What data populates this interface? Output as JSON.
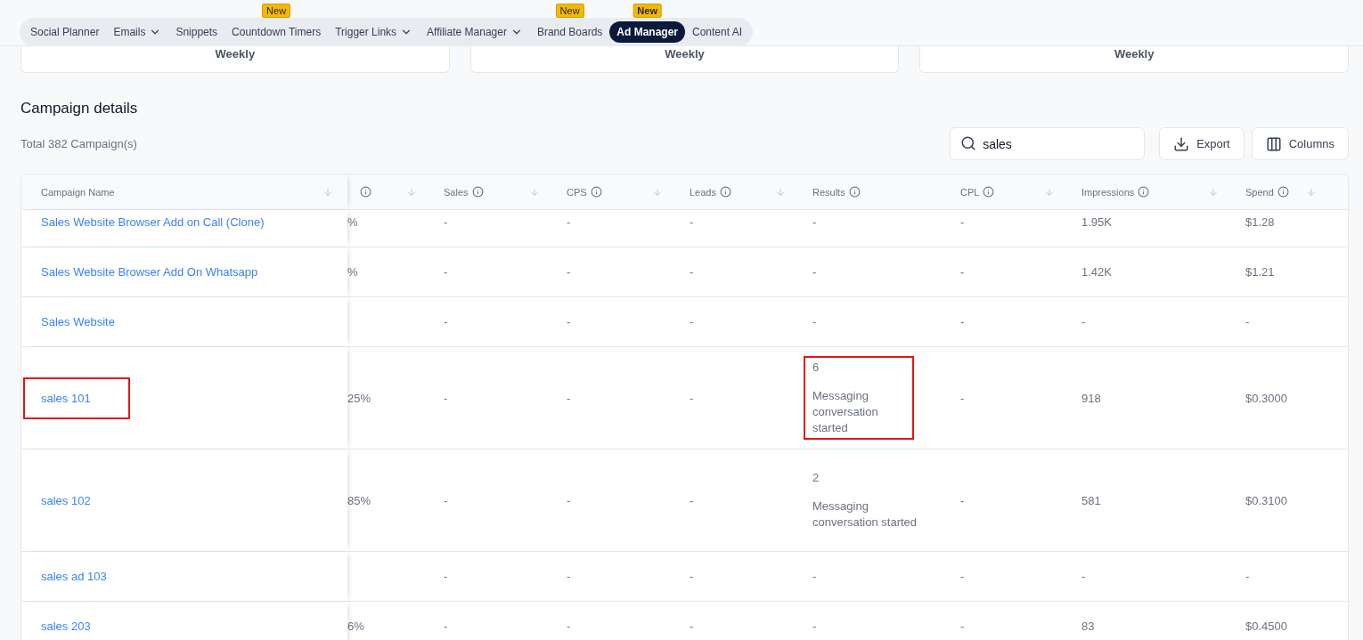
{
  "nav": {
    "items": [
      {
        "label": "Social Planner",
        "dropdown": false,
        "selected": false
      },
      {
        "label": "Emails",
        "dropdown": true,
        "selected": false
      },
      {
        "label": "Snippets",
        "dropdown": false,
        "selected": false
      },
      {
        "label": "Countdown Timers",
        "dropdown": false,
        "badge": "New",
        "selected": false
      },
      {
        "label": "Trigger Links",
        "dropdown": true,
        "selected": false
      },
      {
        "label": "Affiliate Manager",
        "dropdown": true,
        "selected": false
      },
      {
        "label": "Brand Boards",
        "dropdown": false,
        "badge": "New",
        "selected": false
      },
      {
        "label": "Ad Manager",
        "dropdown": false,
        "badge": "New",
        "selected": true
      },
      {
        "label": "Content AI",
        "dropdown": false,
        "selected": false
      }
    ]
  },
  "summary_cards": [
    {
      "period": "Weekly"
    },
    {
      "period": "Weekly"
    },
    {
      "period": "Weekly"
    }
  ],
  "section": {
    "title": "Campaign details",
    "total": "Total 382 Campaign(s)"
  },
  "search": {
    "value": "sales"
  },
  "buttons": [
    {
      "kind": "export",
      "label": "Export"
    },
    {
      "kind": "columns",
      "label": "Columns"
    }
  ],
  "table": {
    "columns": [
      {
        "label": "Campaign Name",
        "info": false,
        "sort": true
      },
      {
        "info": true,
        "sort": true
      },
      {
        "label": "Sales",
        "info": true,
        "sort": true
      },
      {
        "label": "CPS",
        "info": true,
        "sort": true
      },
      {
        "label": "Leads",
        "info": true,
        "sort": true
      },
      {
        "label": "Results",
        "info": true,
        "sort": false
      },
      {
        "label": "CPL",
        "info": true,
        "sort": true
      },
      {
        "label": "Impressions",
        "info": true,
        "sort": true
      },
      {
        "label": "Spend",
        "info": true,
        "sort": true
      }
    ],
    "rows": [
      {
        "name": "Sales Website Browser Add on Call (Clone)",
        "column_2": "%",
        "sales": "-",
        "cps": "-",
        "leads": "-",
        "results": {
          "value": "-"
        },
        "cpl": "-",
        "impressions": "1.95K",
        "spend": "$1.28",
        "highlighted": false
      },
      {
        "name": "Sales Website Browser Add On Whatsapp",
        "column_2": "%",
        "sales": "-",
        "cps": "-",
        "leads": "-",
        "results": {
          "value": "-"
        },
        "cpl": "-",
        "impressions": "1.42K",
        "spend": "$1.21",
        "highlighted": false
      },
      {
        "name": "Sales Website",
        "sales": "-",
        "cps": "-",
        "leads": "-",
        "results": {
          "value": "-"
        },
        "cpl": "-",
        "impressions": "-",
        "spend": "-",
        "highlighted": false
      },
      {
        "name": "sales 101",
        "column_2": "25%",
        "sales": "-",
        "cps": "-",
        "leads": "-",
        "results": {
          "value": "6",
          "label": "Messaging conversation started"
        },
        "cpl": "-",
        "impressions": "918",
        "spend": "$0.3000",
        "highlighted": true
      },
      {
        "name": "sales 102",
        "column_2": "85%",
        "sales": "-",
        "cps": "-",
        "leads": "-",
        "results": {
          "value": "2",
          "label": "Messaging conversation started"
        },
        "cpl": "-",
        "impressions": "581",
        "spend": "$0.3100",
        "highlighted": false
      },
      {
        "name": "sales ad 103",
        "sales": "-",
        "cps": "-",
        "leads": "-",
        "results": {
          "value": "-"
        },
        "cpl": "-",
        "impressions": "-",
        "spend": "-",
        "highlighted": false
      },
      {
        "name": "sales 203",
        "column_2": "6%",
        "sales": "-",
        "cps": "-",
        "leads": "-",
        "results": {
          "value": "-"
        },
        "cpl": "-",
        "impressions": "83",
        "spend": "$0.4500",
        "highlighted": false
      }
    ]
  }
}
